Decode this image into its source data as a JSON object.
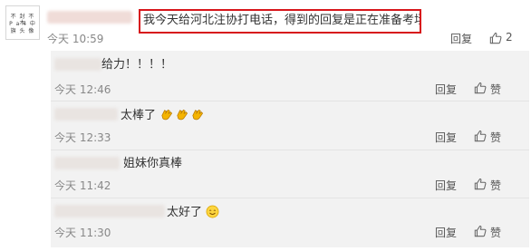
{
  "post": {
    "text": "我今天给河北注协打电话，得到的回复是正在准备考场",
    "time": "今天 10:59",
    "reply_label": "回复",
    "like_count": "2",
    "avatar_lines": [
      "不 封 不 木",
      "P a 4 中",
      "旗 头 像"
    ]
  },
  "replies": [
    {
      "text": "给力！！！！",
      "time": "今天 12:46",
      "reply_label": "回复",
      "like_label": "赞"
    },
    {
      "text": "太棒了",
      "time": "今天 12:33",
      "reply_label": "回复",
      "like_label": "赞"
    },
    {
      "text": "姐妹你真棒",
      "time": "今天 11:42",
      "reply_label": "回复",
      "like_label": "赞"
    },
    {
      "text": "太好了",
      "time": "今天 11:30",
      "reply_label": "回复",
      "like_label": "赞"
    }
  ],
  "icons": {
    "like": "thumbs-up-icon",
    "clap": "clapping-hands-emoji",
    "smile": "smiling-face-emoji"
  },
  "colors": {
    "highlight_border": "#d7161b",
    "panel_bg": "#f2f2f2"
  }
}
